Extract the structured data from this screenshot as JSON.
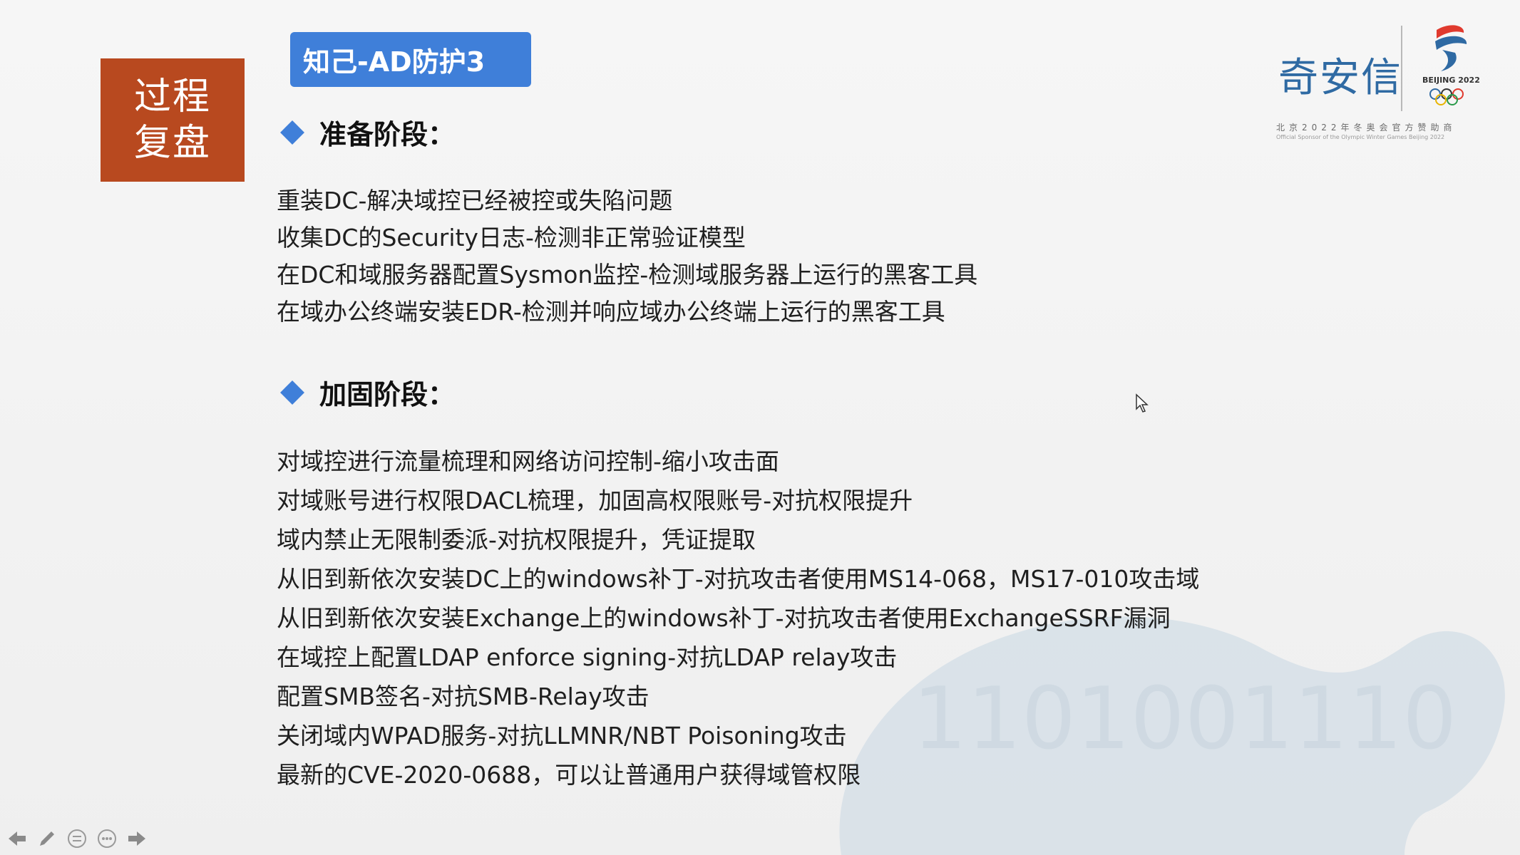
{
  "badge": {
    "line1": "过程",
    "line2": "复盘"
  },
  "title": "知己-AD防护3",
  "logo": {
    "brand": "奇安信",
    "emblem_text": "BEIJING 2022",
    "sponsor_cn": "北京2022年冬奥会官方赞助商",
    "sponsor_en": "Official Sponsor of the Olympic Winter Games Beijing 2022"
  },
  "sections": [
    {
      "heading": "准备阶段：",
      "items": [
        "重装DC-解决域控已经被控或失陷问题",
        "收集DC的Security日志-检测非正常验证模型",
        "在DC和域服务器配置Sysmon监控-检测域服务器上运行的黑客工具",
        "在域办公终端安装EDR-检测并响应域办公终端上运行的黑客工具"
      ]
    },
    {
      "heading": "加固阶段：",
      "items": [
        "对域控进行流量梳理和网络访问控制-缩小攻击面",
        "对域账号进行权限DACL梳理，加固高权限账号-对抗权限提升",
        "域内禁止无限制委派-对抗权限提升，凭证提取",
        "从旧到新依次安装DC上的windows补丁-对抗攻击者使用MS14-068，MS17-010攻击域",
        "从旧到新依次安装Exchange上的windows补丁-对抗攻击者使用ExchangeSSRF漏洞",
        "在域控上配置LDAP enforce signing-对抗LDAP relay攻击",
        "配置SMB签名-对抗SMB-Relay攻击",
        "关闭域内WPAD服务-对抗LLMNR/NBT Poisoning攻击",
        "最新的CVE-2020-0688，可以让普通用户获得域管权限"
      ]
    }
  ],
  "watermark_digits": "1101001110",
  "controls": [
    "prev-arrow-icon",
    "pen-icon",
    "menu-icon",
    "more-icon",
    "next-arrow-icon"
  ],
  "colors": {
    "badge": "#b8491f",
    "accent": "#3f7fd9",
    "brand": "#2f6aa3"
  }
}
